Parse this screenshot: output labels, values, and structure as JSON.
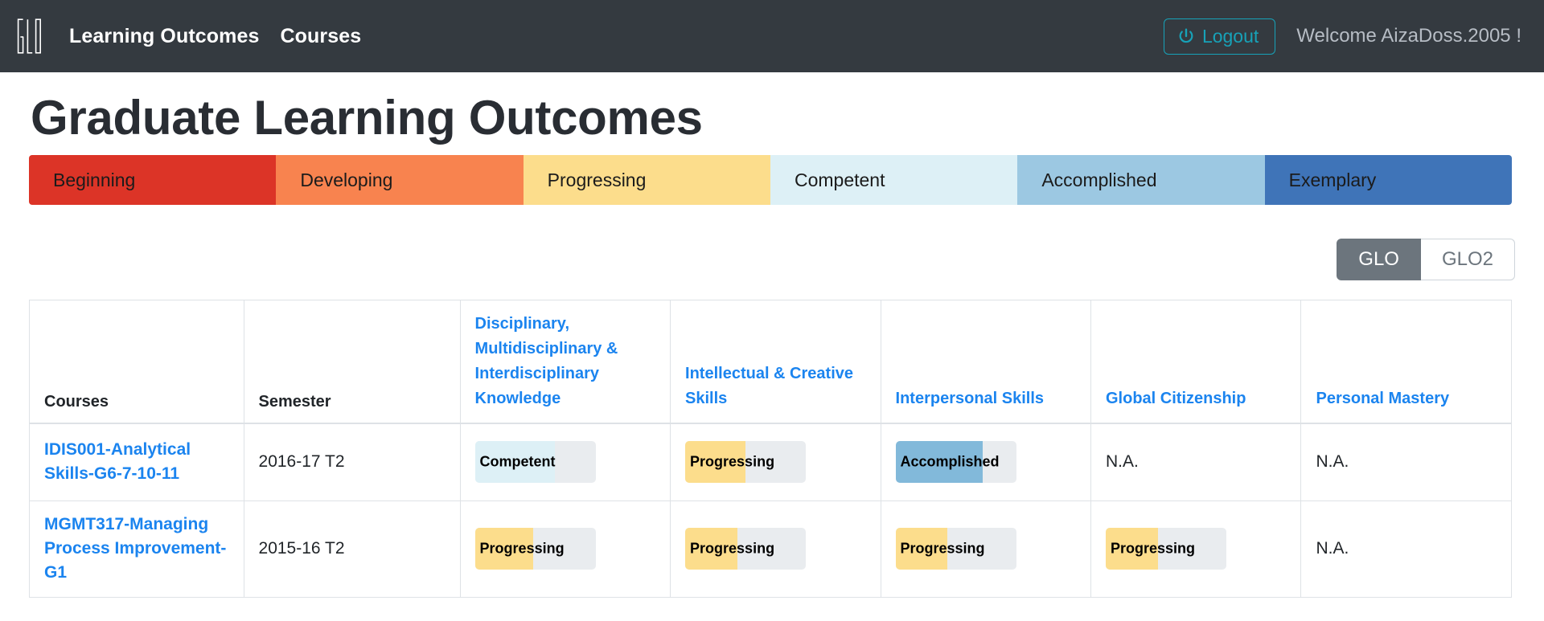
{
  "navbar": {
    "logo_text": "GLO",
    "links": [
      {
        "label": "Learning Outcomes"
      },
      {
        "label": "Courses"
      }
    ],
    "logout_label": "Logout",
    "welcome_text": "Welcome AizaDoss.2005 !",
    "accent_color": "#17a2b8",
    "background_color": "#343a40"
  },
  "page": {
    "title": "Graduate Learning Outcomes"
  },
  "legend": {
    "items": [
      {
        "label": "Beginning",
        "color": "#dc3427"
      },
      {
        "label": "Developing",
        "color": "#f8834f"
      },
      {
        "label": "Progressing",
        "color": "#fcdd8c"
      },
      {
        "label": "Competent",
        "color": "#ddf0f6"
      },
      {
        "label": "Accomplished",
        "color": "#9cc8e2"
      },
      {
        "label": "Exemplary",
        "color": "#3f74b8"
      }
    ]
  },
  "toggle": {
    "options": [
      {
        "label": "GLO",
        "active": true
      },
      {
        "label": "GLO2",
        "active": false
      }
    ]
  },
  "table": {
    "headers": [
      {
        "label": "Courses",
        "style": "plain"
      },
      {
        "label": "Semester",
        "style": "plain"
      },
      {
        "label": "Disciplinary, Multidisciplinary & Interdisciplinary Knowledge",
        "style": "link"
      },
      {
        "label": "Intellectual & Creative Skills",
        "style": "link"
      },
      {
        "label": "Interpersonal Skills",
        "style": "link"
      },
      {
        "label": "Global Citizenship",
        "style": "link"
      },
      {
        "label": "Personal Mastery",
        "style": "link"
      }
    ],
    "rows": [
      {
        "course": "IDIS001-Analytical Skills-G6-7-10-11",
        "semester": "2016-17 T2",
        "cells": [
          {
            "type": "progress",
            "label": "Competent",
            "percent": 66,
            "color": "#ddf0f6"
          },
          {
            "type": "progress",
            "label": "Progressing",
            "percent": 50,
            "color": "#fcdd8c"
          },
          {
            "type": "progress",
            "label": "Accomplished",
            "percent": 72,
            "color": "#82b9da"
          },
          {
            "type": "text",
            "label": "N.A."
          },
          {
            "type": "text",
            "label": "N.A."
          }
        ]
      },
      {
        "course": "MGMT317-Managing Process Improvement-G1",
        "semester": "2015-16 T2",
        "cells": [
          {
            "type": "progress",
            "label": "Progressing",
            "percent": 48,
            "color": "#fcdd8c"
          },
          {
            "type": "progress",
            "label": "Progressing",
            "percent": 43,
            "color": "#fcdd8c"
          },
          {
            "type": "progress",
            "label": "Progressing",
            "percent": 43,
            "color": "#fcdd8c"
          },
          {
            "type": "progress",
            "label": "Progressing",
            "percent": 43,
            "color": "#fcdd8c"
          },
          {
            "type": "text",
            "label": "N.A."
          }
        ]
      }
    ]
  }
}
